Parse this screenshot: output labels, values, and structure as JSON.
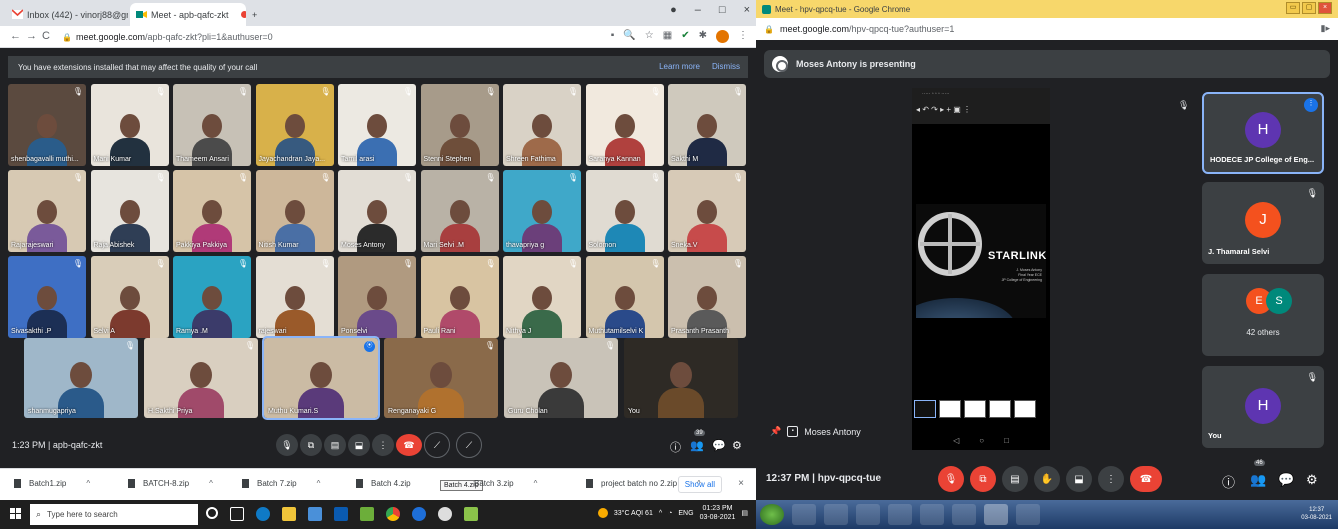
{
  "left": {
    "tabs": [
      {
        "label": "Inbox (442) - vinorj88@gmail.co",
        "close": "×"
      },
      {
        "label": "Meet - apb-qafc-zkt",
        "close": "×"
      }
    ],
    "new_tab": "+",
    "window_controls": [
      "–",
      "□",
      "×"
    ],
    "nav": {
      "back": "←",
      "forward": "→",
      "reload": "C"
    },
    "url_host": "meet.google.com",
    "url_path": "/apb-qafc-zkt?pli=1&authuser=0",
    "ext_icons": [
      "▪",
      "🔍",
      "☆",
      "▦",
      "✔",
      "✱"
    ],
    "menu": "⋮",
    "warning": {
      "text": "You have extensions installed that may affect the quality of your call",
      "learn_more": "Learn more",
      "dismiss": "Dismiss"
    },
    "participants": [
      {
        "name": "shenbagavalli muthi...",
        "bg": "#5b4a3f",
        "shirt": "#2a5c8a",
        "mic": "🎙"
      },
      {
        "name": "Mani Kumar",
        "bg": "#e9e4dc",
        "shirt": "#22313f",
        "mic": "🎙"
      },
      {
        "name": "Thameem Ansari",
        "bg": "#c7c1b6",
        "shirt": "#4b4b4b",
        "mic": "🎙"
      },
      {
        "name": "Jayachandran Jaya...",
        "bg": "#d8b14a",
        "shirt": "#375a7f",
        "mic": "🎙"
      },
      {
        "name": "Tamil arasi",
        "bg": "#ece9e2",
        "shirt": "#3b6fb2",
        "mic": "🎙"
      },
      {
        "name": "Stenni Stephen",
        "bg": "#a79b8a",
        "shirt": "#6e4e3a",
        "mic": "🎙"
      },
      {
        "name": "Shreen Fathima",
        "bg": "#d9d2c6",
        "shirt": "#9e6a4a",
        "mic": "🎙"
      },
      {
        "name": "Saranya Kannan",
        "bg": "#f1e9de",
        "shirt": "#b0413e",
        "mic": "🎙"
      },
      {
        "name": "Sakthi M",
        "bg": "#cfc9bd",
        "shirt": "#1f2a44",
        "mic": "🎙"
      },
      {
        "name": "Rajarajeswari",
        "bg": "#d7c9b3",
        "shirt": "#7a5a9a",
        "mic": "🎙"
      },
      {
        "name": "Raja Abishek",
        "bg": "#e7e4de",
        "shirt": "#2f3e55",
        "mic": "🎙"
      },
      {
        "name": "Pakkiya Pakkiya",
        "bg": "#d6c4a8",
        "shirt": "#b03a78",
        "mic": "🎙"
      },
      {
        "name": "Nitish Kumar",
        "bg": "#cdb79a",
        "shirt": "#4a6fa5",
        "mic": "🎙"
      },
      {
        "name": "Moses Antony",
        "bg": "#e2ddd5",
        "shirt": "#2b2b2b",
        "mic": "🎙"
      },
      {
        "name": "Mari Selvi .M",
        "bg": "#b9b2a6",
        "shirt": "#a83f3f",
        "mic": "🎙"
      },
      {
        "name": "thavapriya g",
        "bg": "#3fa8c9",
        "shirt": "#6b3f7a",
        "mic": "🎙"
      },
      {
        "name": "Solomon",
        "bg": "#e0dbd2",
        "shirt": "#1e88b6",
        "mic": "🎙"
      },
      {
        "name": "Sneka.V",
        "bg": "#d7cab7",
        "shirt": "#c74b4b",
        "mic": "🎙"
      },
      {
        "name": "Sivasakthi .P",
        "bg": "#3e6fc4",
        "shirt": "#1c2f55",
        "mic": "🎙"
      },
      {
        "name": "Selvi A",
        "bg": "#d9cdb9",
        "shirt": "#7c3a2e",
        "mic": "🎙"
      },
      {
        "name": "Ramya .M",
        "bg": "#2aa3c2",
        "shirt": "#3b3b6a",
        "mic": "🎙"
      },
      {
        "name": "rajeswari",
        "bg": "#e4ded4",
        "shirt": "#9a5a2a",
        "mic": "🎙"
      },
      {
        "name": "Ponselvi",
        "bg": "#b09a80",
        "shirt": "#6a4a8a",
        "mic": "🎙"
      },
      {
        "name": "Pauli Rani",
        "bg": "#d8c4a2",
        "shirt": "#b04a6a",
        "mic": "🎙"
      },
      {
        "name": "Nithya J",
        "bg": "#e1d6c4",
        "shirt": "#3a6a4a",
        "mic": "🎙"
      },
      {
        "name": "Muthutamilselvi K",
        "bg": "#d4c6ad",
        "shirt": "#2a4a8a",
        "mic": "🎙"
      },
      {
        "name": "Prasanth Prasanth",
        "bg": "#cbbfae",
        "shirt": "#5a5a5a",
        "mic": "🎙"
      }
    ],
    "bottom_row": [
      {
        "name": "shanmugapriya",
        "bg": "#9fb7c9",
        "shirt": "#2a5a8a",
        "mic": "🎙"
      },
      {
        "name": "H.Sakthi Priya",
        "bg": "#d9cfc0",
        "shirt": "#a04a6a",
        "mic": "🎙"
      },
      {
        "name": "Muthu Kumari.S",
        "bg": "#cbbba4",
        "shirt": "#5a3a7a",
        "mic": "⦿"
      },
      {
        "name": "Renganayaki G",
        "bg": "#8a6a4a",
        "shirt": "#b0712e",
        "mic": "🎙"
      },
      {
        "name": "Guru Cholan",
        "bg": "#c9c3b8",
        "shirt": "#3a3a3a",
        "mic": "🎙"
      },
      {
        "name": "You",
        "bg": "#2e2a25",
        "shirt": "#6a4a2a",
        "mic": ""
      }
    ],
    "meeting_info": "1:23 PM  |  apb-qafc-zkt",
    "controls": [
      "🎙",
      "⧉",
      "▤",
      "⬓",
      "⋮",
      "☎",
      "⟋",
      "⟋"
    ],
    "right_controls": [
      "ⓘ",
      "👥",
      "💬",
      "⚙"
    ],
    "participant_count": "39",
    "downloads": [
      {
        "name": "Batch1.zip",
        "caret": "^"
      },
      {
        "name": "BATCH-8.zip",
        "caret": "^"
      },
      {
        "name": "Batch 7.zip",
        "caret": "^"
      },
      {
        "name": "Batch 4.zip",
        "caret": "^"
      },
      {
        "name": "Batch 3.zip",
        "caret": "^"
      },
      {
        "name": "project batch no 2.zip",
        "caret": "^"
      }
    ],
    "download_tooltip": "Batch 4.zip",
    "show_all": "Show all",
    "dl_close": "×",
    "taskbar": {
      "search_placeholder": "Type here to search",
      "weather": "33°C  AQI 61",
      "tray_caret": "^",
      "lang": "ENG",
      "time": "01:23 PM",
      "date": "03-08-2021"
    }
  },
  "right": {
    "window_title": "Meet - hpv-qpcq-tue - Google Chrome",
    "window_buttons": [
      "▭",
      "▢",
      "×"
    ],
    "url_host": "meet.google.com",
    "url_path": "/hpv-qpcq-tue?authuser=1",
    "ext": "▮▸",
    "presenting": "Moses Antony is presenting",
    "slide": {
      "title": "STARLINK",
      "subtitle": "J. Moses Antony\nFinal Year ECE\nJP College of Engineering",
      "toolbar_text": "◂  ↶  ↷  ▸  +  ▣  ⋮",
      "toolbar_small": "·····   ▫ ▫ ▫   ·····",
      "nav": [
        "◁",
        "○",
        "□"
      ]
    },
    "presenter_name": "Moses Antony",
    "tiles": [
      {
        "initial": "H",
        "name": "HODECE JP College of Eng...",
        "color": "#5e35b1",
        "mic": ""
      },
      {
        "initial": "J",
        "name": "J. Thamaral Selvi",
        "color": "#f4511e",
        "mic": "🎙"
      },
      {
        "initial": "",
        "name": "",
        "color": "",
        "mic": "",
        "others": "42 others",
        "initials": [
          "E",
          "S"
        ]
      },
      {
        "initial": "H",
        "name": "You",
        "color": "#5e35b1",
        "mic": "🎙"
      }
    ],
    "tiles_menu": "⋮",
    "stage_mic": "🎙",
    "meeting_info": "12:37 PM  |  hpv-qpcq-tue",
    "controls": [
      "🎙",
      "⧉",
      "▤",
      "✋",
      "⬓",
      "⋮",
      "☎"
    ],
    "right_controls": [
      "ⓘ",
      "👥",
      "💬",
      "⚙"
    ],
    "participant_count": "46",
    "tray_time": "12:37",
    "tray_date": "03-08-2021"
  }
}
